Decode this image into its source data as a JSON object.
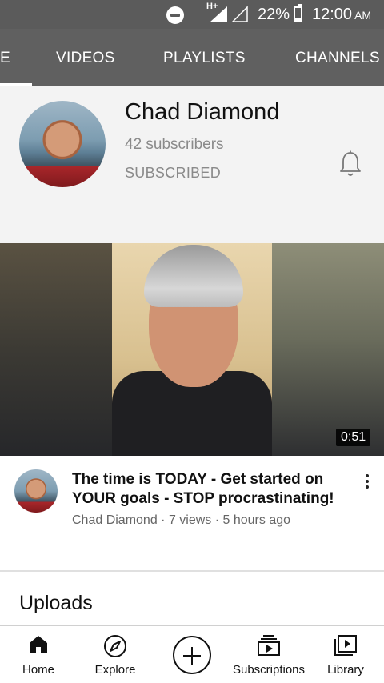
{
  "status_bar": {
    "network_label": "H+",
    "battery_percent": "22%",
    "battery_level": 0.22,
    "time": "12:00",
    "ampm": "AM",
    "icons": [
      "do-not-disturb-icon",
      "signal-icon",
      "signal-empty-icon",
      "battery-icon"
    ]
  },
  "tabs": [
    {
      "label": "E"
    },
    {
      "label": "VIDEOS"
    },
    {
      "label": "PLAYLISTS"
    },
    {
      "label": "CHANNELS"
    }
  ],
  "channel": {
    "name": "Chad Diamond",
    "subscribers": "42 subscribers",
    "subscribed_label": "SUBSCRIBED",
    "notification_icon": "bell-icon"
  },
  "featured_video": {
    "duration": "0:51",
    "title": "The time is TODAY - Get started on YOUR goals - STOP procrastinating!",
    "meta": "Chad Diamond · 7 views · 5 hours ago"
  },
  "section": {
    "uploads_title": "Uploads"
  },
  "bottom_nav": [
    {
      "label": "Home",
      "icon": "home-icon"
    },
    {
      "label": "Explore",
      "icon": "compass-icon"
    },
    {
      "label": "",
      "icon": "add-icon"
    },
    {
      "label": "Subscriptions",
      "icon": "subscriptions-icon"
    },
    {
      "label": "Library",
      "icon": "library-icon"
    }
  ],
  "colors": {
    "status_bar": "#5b5b5b",
    "tab_bar": "#606060",
    "channel_bg": "#f3f3f3",
    "secondary_text": "#8a8a8a"
  }
}
